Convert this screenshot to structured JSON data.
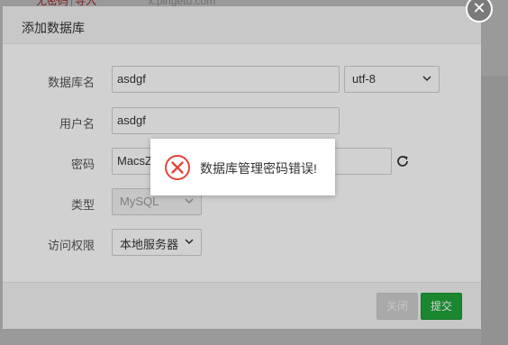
{
  "background": {
    "top_link_1": "无密码",
    "separator": "|",
    "top_link_2": "导入",
    "host": "x.pingetu.com"
  },
  "dialog": {
    "title": "添加数据库",
    "close_icon": "close-icon"
  },
  "form": {
    "db_name_label": "数据库名",
    "db_name_value": "asdgf",
    "charset_value": "utf-8",
    "username_label": "用户名",
    "username_value": "asdgf",
    "password_label": "密码",
    "password_value": "MacsZ",
    "refresh_icon": "refresh-icon",
    "type_label": "类型",
    "type_value": "MySQL",
    "access_label": "访问权限",
    "access_value": "本地服务器"
  },
  "footer": {
    "close_label": "关闭",
    "submit_label": "提交"
  },
  "toast": {
    "icon": "error-circle-icon",
    "message": "数据库管理密码错误!"
  },
  "colors": {
    "submit_green": "#20a53a",
    "error_red": "#e2453b",
    "overlay_gray": "#8f8f8f"
  }
}
